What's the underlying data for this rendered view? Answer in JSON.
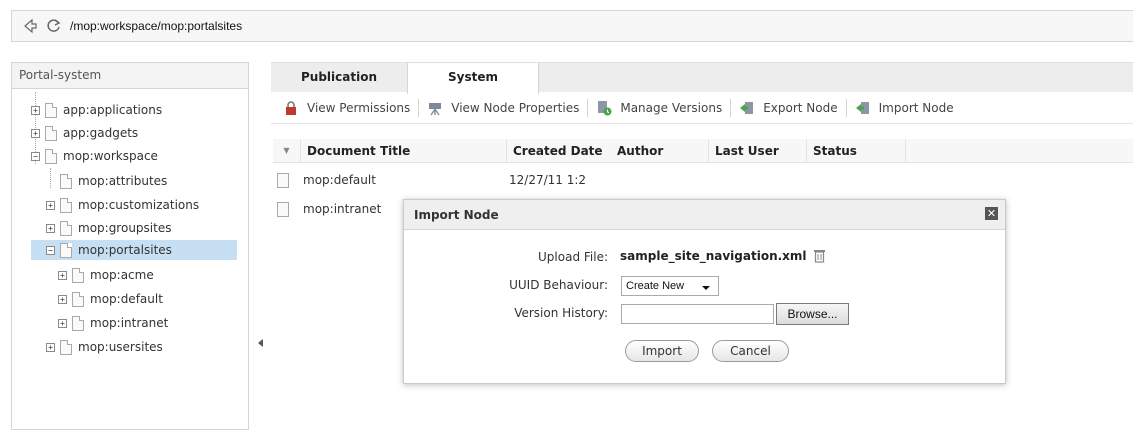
{
  "address_bar": {
    "path": "/mop:workspace/mop:portalsites"
  },
  "tree": {
    "header": "Portal-system",
    "nodes": [
      {
        "label": "app:applications",
        "expander": "+"
      },
      {
        "label": "app:gadgets",
        "expander": "+"
      },
      {
        "label": "mop:workspace",
        "expander": "−"
      },
      {
        "label": "mop:attributes",
        "expander": ""
      },
      {
        "label": "mop:customizations",
        "expander": "+"
      },
      {
        "label": "mop:groupsites",
        "expander": "+"
      },
      {
        "label": "mop:portalsites",
        "expander": "−"
      },
      {
        "label": "mop:acme",
        "expander": "+"
      },
      {
        "label": "mop:default",
        "expander": "+"
      },
      {
        "label": "mop:intranet",
        "expander": "+"
      },
      {
        "label": "mop:usersites",
        "expander": "+"
      }
    ]
  },
  "tabs": [
    {
      "label": "Publication"
    },
    {
      "label": "System"
    }
  ],
  "toolbar": {
    "view_permissions": "View Permissions",
    "view_node_properties": "View Node Properties",
    "manage_versions": "Manage Versions",
    "export_node": "Export Node",
    "import_node": "Import Node"
  },
  "grid": {
    "columns": [
      "Document Title",
      "Created Date",
      "Author",
      "Last User",
      "Status"
    ],
    "rows": [
      {
        "title": "mop:default",
        "created": "12/27/11 1:2"
      },
      {
        "title": "mop:intranet",
        "created": ""
      }
    ]
  },
  "dialog": {
    "title": "Import Node",
    "upload_file_label": "Upload File:",
    "upload_file_value": "sample_site_navigation.xml",
    "uuid_label": "UUID Behaviour:",
    "uuid_value": "Create New",
    "version_history_label": "Version History:",
    "browse_label": "Browse...",
    "import_label": "Import",
    "cancel_label": "Cancel"
  },
  "colors": {
    "selection": "#c6dff3",
    "accent_green": "#4aa64a",
    "lock_red": "#c0392b"
  }
}
